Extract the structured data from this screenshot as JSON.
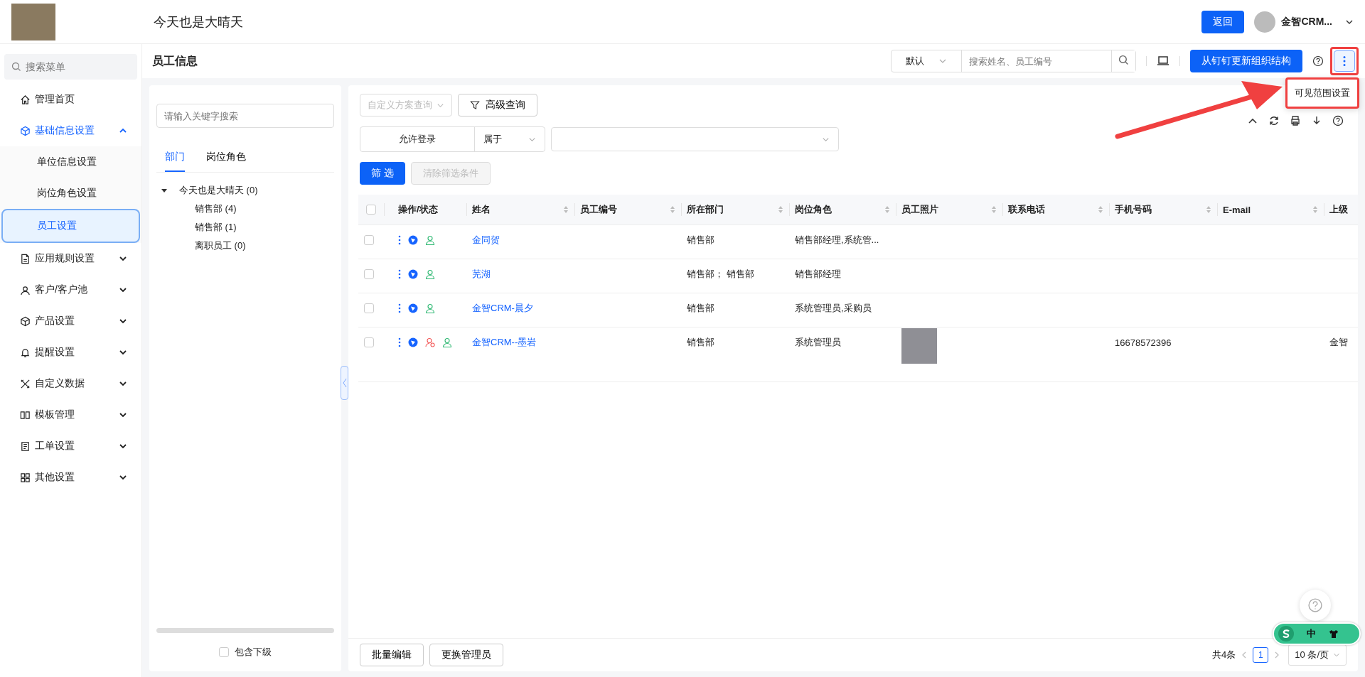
{
  "header": {
    "title": "今天也是大晴天",
    "back_button": "返回",
    "user_name": "金智CRM..."
  },
  "sidebar": {
    "search_placeholder": "搜索菜单",
    "items": [
      {
        "kind": "link",
        "label": "管理首页"
      },
      {
        "kind": "group",
        "label": "基础信息设置",
        "expanded": true,
        "children": [
          {
            "label": "单位信息设置",
            "selected": false
          },
          {
            "label": "岗位角色设置",
            "selected": false
          },
          {
            "label": "员工设置",
            "selected": true
          }
        ]
      },
      {
        "kind": "group",
        "label": "应用规则设置",
        "expanded": false
      },
      {
        "kind": "group",
        "label": "客户/客户池",
        "expanded": false
      },
      {
        "kind": "group",
        "label": "产品设置",
        "expanded": false
      },
      {
        "kind": "group",
        "label": "提醒设置",
        "expanded": false
      },
      {
        "kind": "group",
        "label": "自定义数据",
        "expanded": false
      },
      {
        "kind": "group",
        "label": "模板管理",
        "expanded": false
      },
      {
        "kind": "group",
        "label": "工单设置",
        "expanded": false
      },
      {
        "kind": "group",
        "label": "其他设置",
        "expanded": false
      }
    ]
  },
  "page": {
    "title": "员工信息",
    "scope_select": "默认",
    "search_placeholder": "搜索姓名、员工编号",
    "sync_button": "从钉钉更新组织结构",
    "more_menu": {
      "open": true,
      "items": [
        "可见范围设置"
      ]
    }
  },
  "left_panel": {
    "search_placeholder": "请输入关键字搜索",
    "tabs": [
      {
        "label": "部门",
        "selected": true
      },
      {
        "label": "岗位角色",
        "selected": false
      }
    ],
    "tree": [
      {
        "label": "今天也是大晴天 (0)",
        "expanded": true,
        "children": [
          {
            "label": "销售部 (4)"
          },
          {
            "label": "销售部 (1)"
          },
          {
            "label": "离职员工 (0)"
          }
        ]
      }
    ],
    "include_sub": {
      "label": "包含下级",
      "checked": false
    }
  },
  "filters": {
    "scheme_placeholder": "自定义方案查询",
    "advanced_button": "高级查询",
    "condition": {
      "field": "允许登录",
      "operator": "属于"
    },
    "filter_button": "筛 选",
    "clear_button": {
      "label": "清除筛选条件",
      "disabled": true
    }
  },
  "table": {
    "all_checked": false,
    "columns": [
      {
        "label": "操作/状态",
        "sortable": false
      },
      {
        "label": "姓名",
        "sortable": true
      },
      {
        "label": "员工编号",
        "sortable": true
      },
      {
        "label": "所在部门",
        "sortable": true
      },
      {
        "label": "岗位角色",
        "sortable": true
      },
      {
        "label": "员工照片",
        "sortable": true
      },
      {
        "label": "联系电话",
        "sortable": true
      },
      {
        "label": "手机号码",
        "sortable": true
      },
      {
        "label": "E-mail",
        "sortable": true
      },
      {
        "label": "上级",
        "sortable": false
      }
    ],
    "rows": [
      {
        "name": "金同贺",
        "department": "销售部",
        "role": "销售部经理,系统管...",
        "photo": false,
        "flagged": false,
        "checked": false
      },
      {
        "name": "芜湖",
        "department": "销售部；  销售部",
        "role": "销售部经理",
        "photo": false,
        "flagged": false,
        "checked": false
      },
      {
        "name": "金智CRM-晨夕",
        "department": "销售部",
        "role": "系统管理员,采购员",
        "photo": false,
        "flagged": false,
        "checked": false
      },
      {
        "name": "金智CRM--墨岩",
        "department": "销售部",
        "role": "系统管理员",
        "photo": true,
        "mobile": "16678572396",
        "supervisor": "金智",
        "flagged": true,
        "checked": false
      }
    ]
  },
  "footer": {
    "buttons": [
      "批量编辑",
      "更换管理员"
    ],
    "total": "共4条",
    "pages": [
      {
        "label": "1",
        "selected": true
      }
    ],
    "page_size": "10 条/页"
  },
  "ime_widget": {
    "label": "中"
  }
}
